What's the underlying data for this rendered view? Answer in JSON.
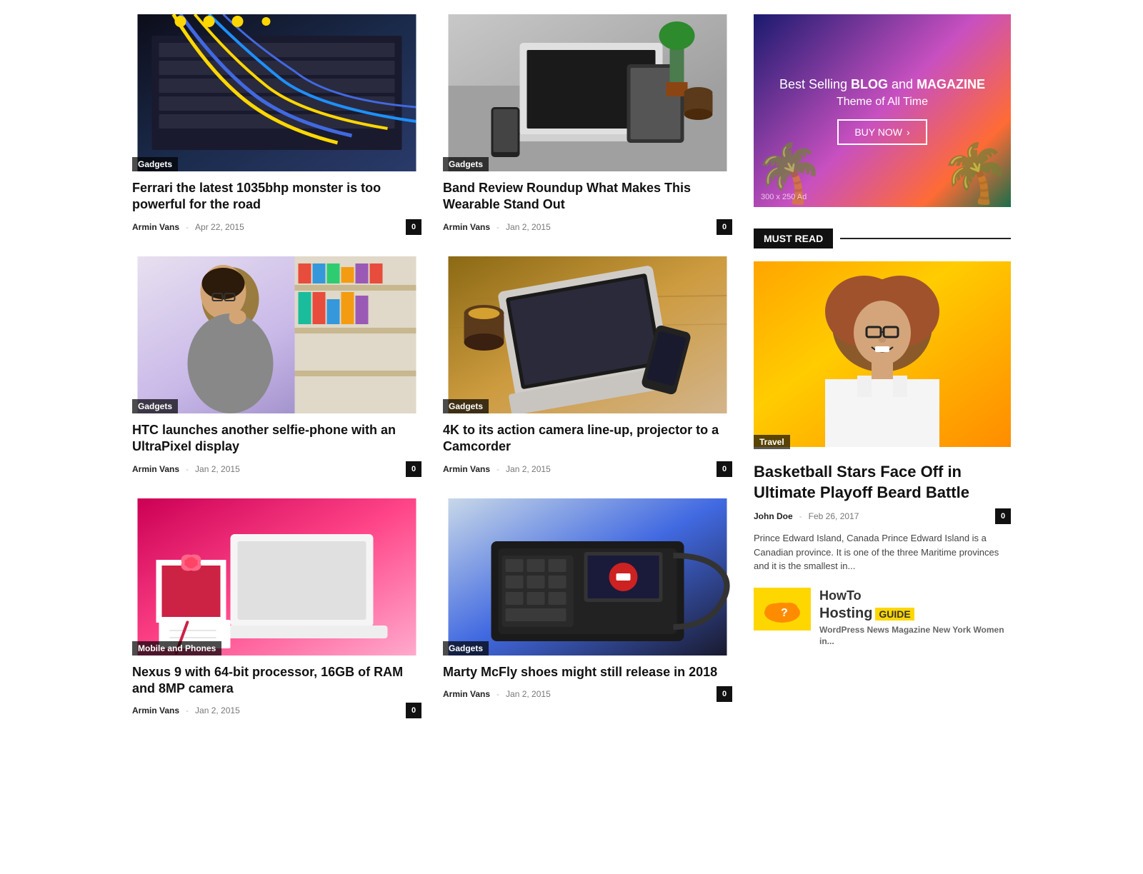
{
  "articles": [
    {
      "id": 1,
      "category": "Gadgets",
      "title": "Ferrari the latest 1035bhp monster is too powerful for the road",
      "author": "Armin Vans",
      "date": "Apr 22, 2015",
      "comments": 0,
      "imgType": "network"
    },
    {
      "id": 2,
      "category": "Gadgets",
      "title": "Band Review Roundup What Makes This Wearable Stand Out",
      "author": "Armin Vans",
      "date": "Jan 2, 2015",
      "comments": 0,
      "imgType": "desk"
    },
    {
      "id": 3,
      "category": "Gadgets",
      "title": "HTC launches another selfie-phone with an UltraPixel display",
      "author": "Armin Vans",
      "date": "Jan 2, 2015",
      "comments": 0,
      "imgType": "woman"
    },
    {
      "id": 4,
      "category": "Gadgets",
      "title": "4K to its action camera line-up, projector to a Camcorder",
      "author": "Armin Vans",
      "date": "Jan 2, 2015",
      "comments": 0,
      "imgType": "laptop"
    },
    {
      "id": 5,
      "category": "Mobile and Phones",
      "title": "Nexus 9 with 64-bit processor, 16GB of RAM and 8MP camera",
      "author": "Armin Vans",
      "date": "Jan 2, 2015",
      "comments": 0,
      "imgType": "gift"
    },
    {
      "id": 6,
      "category": "Gadgets",
      "title": "Marty McFly shoes might still release in 2018",
      "author": "Armin Vans",
      "date": "Jan 2, 2015",
      "comments": 0,
      "imgType": "phone"
    }
  ],
  "sidebar": {
    "ad": {
      "line1": "Best Selling ",
      "blog": "BLOG",
      "and": " and ",
      "magazine": "MAGAZINE",
      "line2": "Theme of All Time",
      "button": "BUY NOW",
      "size_label": "300 x 250 Ad"
    },
    "must_read_label": "MUST READ",
    "featured": {
      "category": "Travel",
      "title": "Basketball Stars Face Off in Ultimate Playoff Beard Battle",
      "author": "John Doe",
      "date": "Feb 26, 2017",
      "comments": 0,
      "description": "Prince Edward Island, Canada Prince Edward Island is a Canadian province. It is one of the three Maritime provinces and it is the smallest in..."
    },
    "bottom_item": {
      "title": "HowTo Hosting GUIDE",
      "subtitle": "WordPress News Magazine New York Women in..."
    }
  }
}
